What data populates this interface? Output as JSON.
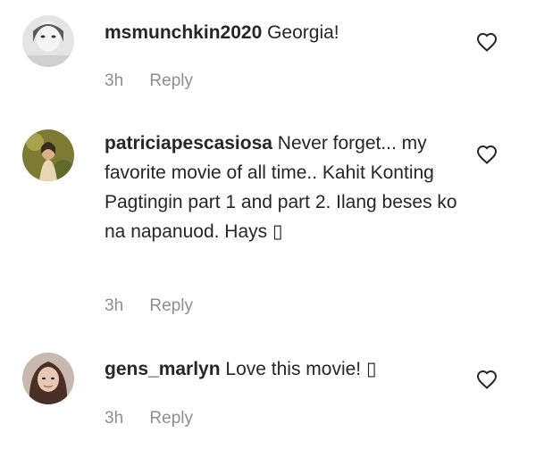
{
  "comments": [
    {
      "username": "msmunchkin2020",
      "text": "Georgia!",
      "time": "3h",
      "reply_label": "Reply",
      "avatar_color": "#d8d8d8"
    },
    {
      "username": "patriciapescasiosa",
      "text": "Never forget... my favorite movie of all time.. Kahit Konting Pagtingin part 1 and part 2. Ilang beses ko na napanuod. Hays ▯",
      "time": "3h",
      "reply_label": "Reply",
      "avatar_color": "#9a8b3a"
    },
    {
      "username": "gens_marlyn",
      "text": "Love this movie! ▯",
      "time": "3h",
      "reply_label": "Reply",
      "avatar_color": "#b89a8a"
    }
  ],
  "icons": {
    "like": "heart-outline-icon"
  }
}
